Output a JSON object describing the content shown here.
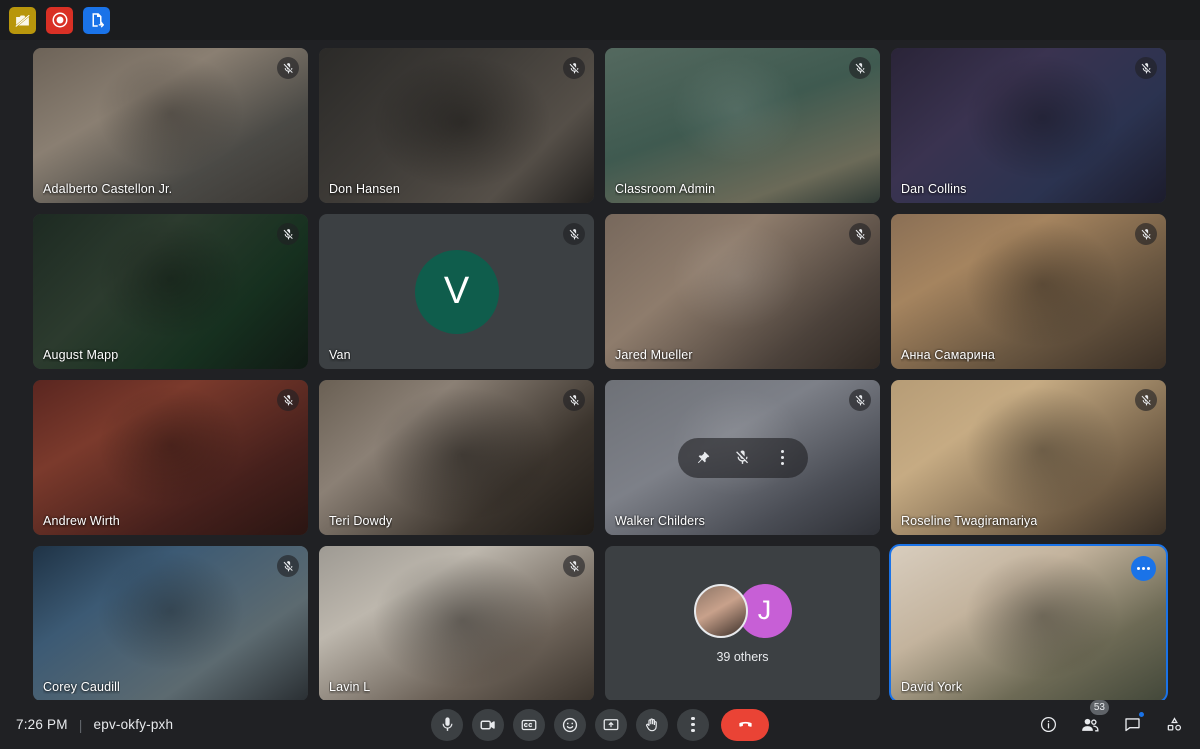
{
  "app": {
    "background_color": "#202124",
    "accent_color": "#1a73e8",
    "end_call_color": "#ea4335"
  },
  "extension_bar": {
    "buttons": [
      {
        "name": "screenshot-disabled-icon",
        "label": "Screenshot off",
        "color": "#b8960c"
      },
      {
        "name": "record-icon",
        "label": "Record",
        "color": "#d93025"
      },
      {
        "name": "export-document-icon",
        "label": "Export",
        "color": "#1a73e8"
      }
    ]
  },
  "grid": {
    "tiles": [
      {
        "name": "Adalberto Castellon Jr.",
        "muted": true,
        "type": "video",
        "bg": "linear-gradient(150deg,#6d6358 0%,#8a7f72 35%,#4b4a46 70%,#3a3733 100%)",
        "self": false
      },
      {
        "name": "Don Hansen",
        "muted": true,
        "type": "video",
        "bg": "linear-gradient(135deg,#2b2a28 0%,#3e3b37 40%,#554f48 75%,#23211f 100%)",
        "self": false
      },
      {
        "name": "Classroom Admin",
        "muted": true,
        "type": "video",
        "bg": "linear-gradient(160deg,#54695f 0%,#3f5a50 45%,#6b6a58 80%,#2f3a35 100%)",
        "self": false
      },
      {
        "name": "Dan Collins",
        "muted": true,
        "type": "video",
        "bg": "linear-gradient(140deg,#2a2438 0%,#3a3350 35%,#2b3350 70%,#1c1c2c 100%)",
        "self": false
      },
      {
        "name": "August Mapp",
        "muted": true,
        "type": "video",
        "bg": "linear-gradient(135deg,#1d2a22 0%,#2c3b2e 35%,#16301f 70%,#101a14 100%)",
        "self": false
      },
      {
        "name": "Van",
        "muted": true,
        "type": "avatar",
        "avatar_letter": "V",
        "avatar_color": "#0f5d4c",
        "self": false
      },
      {
        "name": "Jared Mueller",
        "muted": true,
        "type": "video",
        "bg": "linear-gradient(140deg,#77685c 0%,#8e7c6c 35%,#4c423b 75%,#302924 100%)",
        "self": false
      },
      {
        "name": "Анна Самарина",
        "muted": true,
        "type": "video",
        "bg": "linear-gradient(150deg,#8a6f55 0%,#a5845f 30%,#6a5741 65%,#3b3026 100%)",
        "self": false
      },
      {
        "name": "Andrew Wirth",
        "muted": true,
        "type": "video",
        "bg": "linear-gradient(150deg,#5a2620 0%,#7b3a2c 30%,#46201c 70%,#2a1512 100%)",
        "self": false
      },
      {
        "name": "Teri Dowdy",
        "muted": true,
        "type": "video",
        "bg": "linear-gradient(140deg,#6a6054 0%,#8b8075 30%,#3b342d 70%,#1f1b17 100%)",
        "self": false
      },
      {
        "name": "Walker Childers",
        "muted": true,
        "type": "video",
        "hover_controls": true,
        "bg": "linear-gradient(150deg,#6e7177 0%,#7d8088 40%,#4a4d55 75%,#2e3036 100%)",
        "self": false
      },
      {
        "name": "Roseline Twagiramariya",
        "muted": true,
        "type": "video",
        "bg": "linear-gradient(145deg,#b69c76 0%,#c6ab83 30%,#6d5a43 75%,#3a3026 100%)",
        "self": false
      },
      {
        "name": "Corey Caudill",
        "muted": true,
        "type": "video",
        "bg": "linear-gradient(145deg,#1f3346 0%,#3c5a74 30%,#5c6a70 70%,#2a2f33 100%)",
        "self": false
      },
      {
        "name": "Lavin L",
        "muted": true,
        "type": "video",
        "bg": "linear-gradient(150deg,#9e9a93 0%,#bdb7ad 30%,#6b6157 70%,#3b342d 100%)",
        "self": false
      },
      {
        "name": "",
        "type": "others",
        "others_label": "39 others",
        "others_avatar_letter": "J",
        "others_avatar_color": "#c council",
        "self": false
      },
      {
        "name": "David York",
        "type": "video",
        "self": true,
        "more_menu": true,
        "bg": "linear-gradient(150deg,#d8cdbe 0%,#c3b39d 35%,#6d6a55 70%,#43483a 100%)"
      }
    ],
    "others_tile": {
      "label": "39 others",
      "avatar_letter": "J",
      "avatar_color": "#c75fd6"
    }
  },
  "hover_controls": {
    "pin_label": "Pin",
    "mute_label": "Mute",
    "more_label": "More options"
  },
  "bottom_bar": {
    "time": "7:26 PM",
    "separator": "|",
    "meeting_code": "epv-okfy-pxh",
    "center_buttons": [
      {
        "name": "microphone-button",
        "label": "Turn off microphone"
      },
      {
        "name": "camera-button",
        "label": "Turn off camera"
      },
      {
        "name": "captions-button",
        "label": "Turn on captions"
      },
      {
        "name": "emoji-button",
        "label": "Send a reaction"
      },
      {
        "name": "present-button",
        "label": "Present now"
      },
      {
        "name": "raise-hand-button",
        "label": "Raise hand"
      },
      {
        "name": "more-options-button",
        "label": "More options"
      },
      {
        "name": "end-call-button",
        "label": "Leave call"
      }
    ],
    "right_buttons": [
      {
        "name": "meeting-details-button",
        "label": "Meeting details",
        "badge": ""
      },
      {
        "name": "people-button",
        "label": "People",
        "badge": "53"
      },
      {
        "name": "chat-button",
        "label": "Chat with everyone",
        "badge": "",
        "dot": true
      },
      {
        "name": "activities-button",
        "label": "Activities",
        "badge": ""
      }
    ]
  }
}
